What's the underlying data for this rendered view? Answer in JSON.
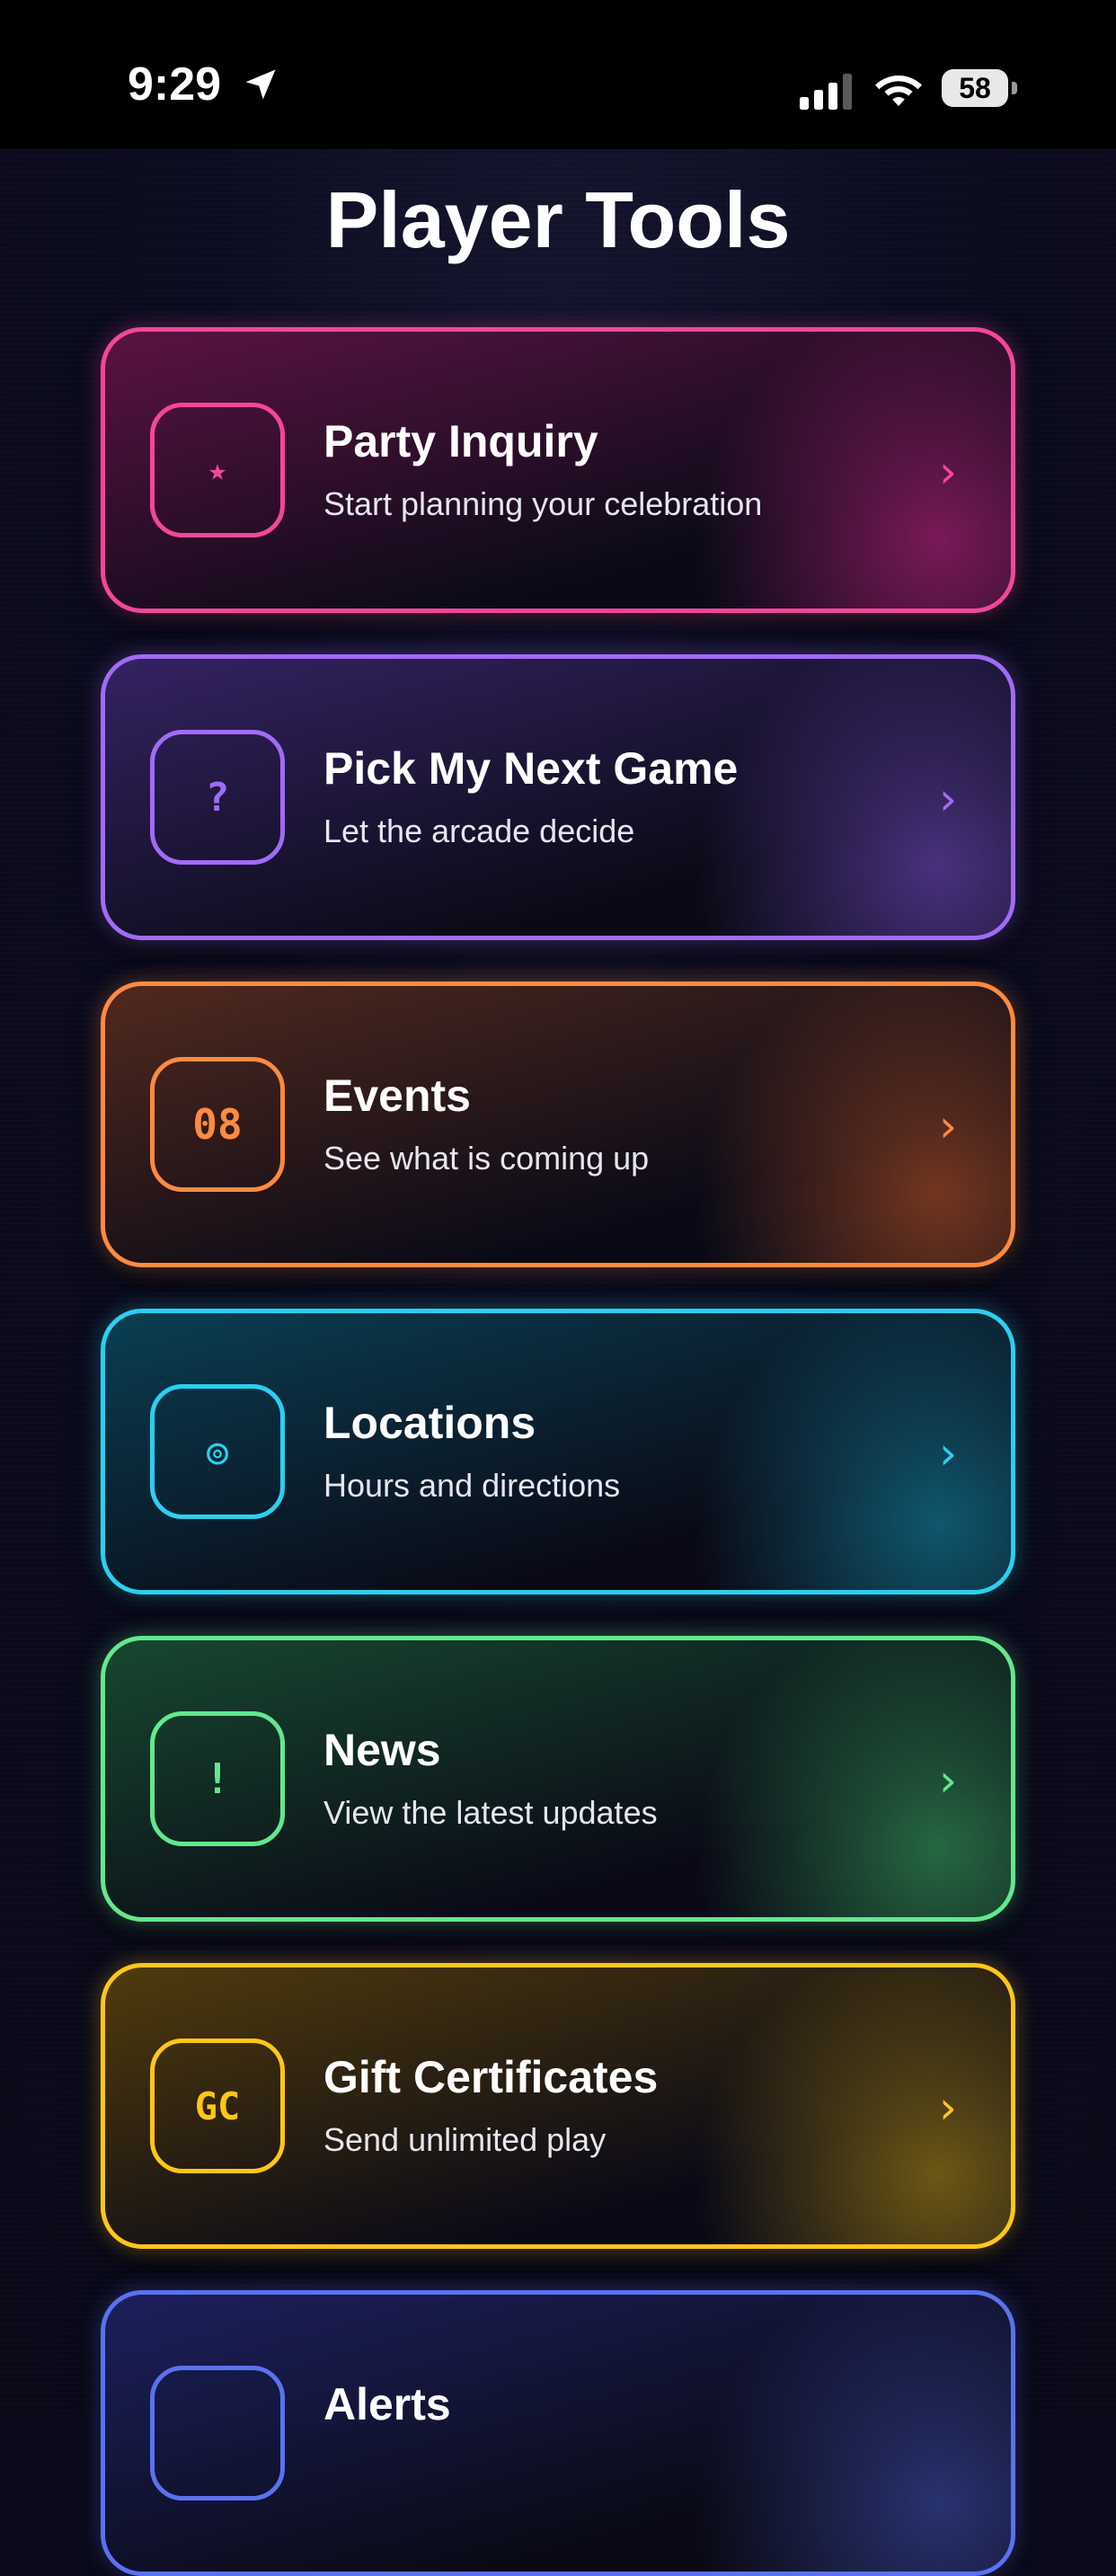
{
  "status_bar": {
    "time": "9:29",
    "battery_level": "58",
    "icons": [
      "location-arrow-icon",
      "cellular-signal-icon",
      "wifi-icon",
      "battery-icon"
    ]
  },
  "page_title": "Player Tools",
  "cards": [
    {
      "title": "Party Inquiry",
      "subtitle": "Start planning your celebration",
      "icon_glyph": "★",
      "icon": "star-icon",
      "chevron": "›",
      "color": "#f2479a"
    },
    {
      "title": "Pick My Next Game",
      "subtitle": "Let the arcade decide",
      "icon_glyph": "?",
      "icon": "question-icon",
      "chevron": "›",
      "color": "#a06cf5"
    },
    {
      "title": "Events",
      "subtitle": "See what is coming up",
      "icon_glyph": "08",
      "icon": "calendar-date-icon",
      "chevron": "›",
      "color": "#ff8a40"
    },
    {
      "title": "Locations",
      "subtitle": "Hours and directions",
      "icon_glyph": "◎",
      "icon": "location-target-icon",
      "chevron": "›",
      "color": "#2ad0ef"
    },
    {
      "title": "News",
      "subtitle": "View the latest updates",
      "icon_glyph": "!",
      "icon": "exclamation-icon",
      "chevron": "›",
      "color": "#62e88e"
    },
    {
      "title": "Gift Certificates",
      "subtitle": "Send unlimited play",
      "icon_glyph": "GC",
      "icon": "gift-certificate-icon",
      "chevron": "›",
      "color": "#ffc61a"
    },
    {
      "title": "Alerts",
      "subtitle": "",
      "icon_glyph": "",
      "icon": "alert-icon",
      "chevron": "",
      "color": "#5a72f0"
    }
  ]
}
